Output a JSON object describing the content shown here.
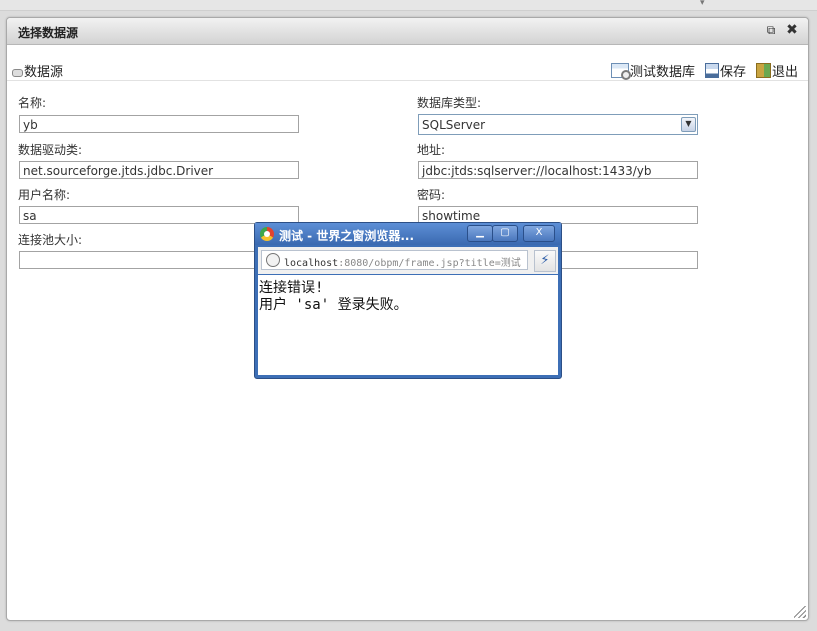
{
  "dialog": {
    "title": "选择数据源"
  },
  "toolbar": {
    "section_title": "数据源",
    "test_label": "测试数据库",
    "save_label": "保存",
    "exit_label": "退出"
  },
  "form": {
    "name_label": "名称:",
    "name_value": "yb",
    "dbtype_label": "数据库类型:",
    "dbtype_value": "SQLServer",
    "driver_label": "数据驱动类:",
    "driver_value": "net.sourceforge.jtds.jdbc.Driver",
    "address_label": "地址:",
    "address_value": "jdbc:jtds:sqlserver://localhost:1433/yb",
    "username_label": "用户名称:",
    "username_value": "sa",
    "password_label": "密码:",
    "password_value": "showtime",
    "pool_label": "连接池大小:",
    "pool_value": ""
  },
  "popup": {
    "title": "测试 - 世界之窗浏览器...",
    "url_host": "localhost",
    "url_rest": ":8080/obpm/frame.jsp?title=测试",
    "message_line1": "连接错误!",
    "message_line2": "用户 'sa' 登录失败。"
  },
  "colors": {
    "popup_frame": "#3d6fb6",
    "dialog_header": "#d3d3d3"
  }
}
